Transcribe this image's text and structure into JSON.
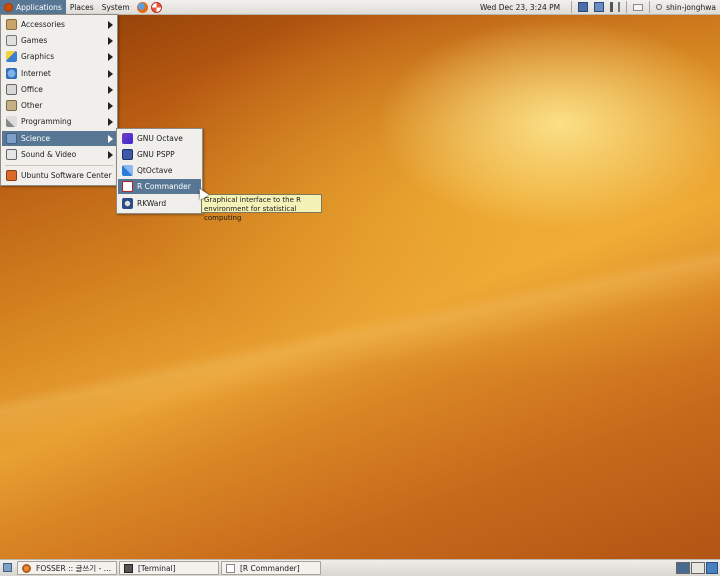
{
  "top_panel": {
    "menus": [
      "Applications",
      "Places",
      "System"
    ],
    "launchers": [
      "firefox-icon",
      "help-icon"
    ],
    "clock": "Wed Dec 23,  3:24 PM",
    "user": "shin-jonghwa"
  },
  "applications_menu": {
    "items": [
      {
        "label": "Accessories",
        "icon": "accessories-icon",
        "submenu": true
      },
      {
        "label": "Games",
        "icon": "games-icon",
        "submenu": true
      },
      {
        "label": "Graphics",
        "icon": "graphics-icon",
        "submenu": true
      },
      {
        "label": "Internet",
        "icon": "internet-icon",
        "submenu": true
      },
      {
        "label": "Office",
        "icon": "office-icon",
        "submenu": true
      },
      {
        "label": "Other",
        "icon": "other-icon",
        "submenu": true
      },
      {
        "label": "Programming",
        "icon": "programming-icon",
        "submenu": true
      },
      {
        "label": "Science",
        "icon": "science-icon",
        "submenu": true,
        "highlighted": true
      },
      {
        "label": "Sound & Video",
        "icon": "sound-video-icon",
        "submenu": true
      },
      {
        "label": "Ubuntu Software Center",
        "icon": "software-center-icon",
        "submenu": false
      }
    ]
  },
  "science_menu": {
    "items": [
      {
        "label": "GNU Octave",
        "icon": "octave-icon"
      },
      {
        "label": "GNU PSPP",
        "icon": "pspp-icon"
      },
      {
        "label": "QtOctave",
        "icon": "qtoctave-icon"
      },
      {
        "label": "R Commander",
        "icon": "r-commander-icon",
        "highlighted": true
      },
      {
        "label": "RKWard",
        "icon": "rkward-icon"
      }
    ]
  },
  "tooltip": {
    "line1": "Graphical interface to the R",
    "line2": "environment for statistical computing"
  },
  "taskbar": {
    "tasks": [
      "FOSSER :: 글쓰기 - …",
      "[Terminal]",
      "[R Commander]"
    ]
  },
  "colors": {
    "highlight": "#587794",
    "panel": "#e8e6e1",
    "desktop_orange": "#d98a22",
    "tooltip_bg": "#f5f2b8"
  }
}
